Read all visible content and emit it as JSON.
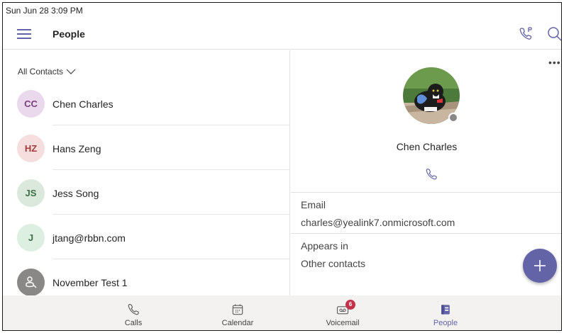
{
  "status_bar": {
    "datetime": "Sun Jun 28  3:09 PM"
  },
  "app_bar": {
    "title": "People"
  },
  "contacts_filter": {
    "label": "All Contacts"
  },
  "contacts": [
    {
      "initials": "CC",
      "name": "Chen Charles",
      "avatar_bg": "#ead9ec",
      "avatar_fg": "#7a3e7e"
    },
    {
      "initials": "HZ",
      "name": "Hans Zeng",
      "avatar_bg": "#f6dede",
      "avatar_fg": "#a33b3b"
    },
    {
      "initials": "JS",
      "name": "Jess Song",
      "avatar_bg": "#dbe9dd",
      "avatar_fg": "#3c6e47"
    },
    {
      "initials": "J",
      "name": "jtang@rbbn.com",
      "avatar_bg": "#dcefe0",
      "avatar_fg": "#3c6e47"
    },
    {
      "initials": "",
      "name": "November Test 1",
      "avatar_bg": "#8a8886",
      "avatar_fg": "#ffffff",
      "avatar_icon": "bot-icon"
    }
  ],
  "detail": {
    "name": "Chen Charles",
    "email_label": "Email",
    "email": "charles@yealink7.onmicrosoft.com",
    "appears_in_label": "Appears in",
    "appears_in": "Other contacts",
    "presence": "offline"
  },
  "nav": [
    {
      "label": "Calls",
      "icon": "phone-icon",
      "active": false
    },
    {
      "label": "Calendar",
      "icon": "calendar-icon",
      "active": false
    },
    {
      "label": "Voicemail",
      "icon": "voicemail-icon",
      "active": false,
      "badge": "6"
    },
    {
      "label": "People",
      "icon": "people-icon",
      "active": true
    }
  ],
  "colors": {
    "accent": "#6264a7",
    "badge": "#c4314b",
    "nav_bg": "#f3f2f1"
  }
}
